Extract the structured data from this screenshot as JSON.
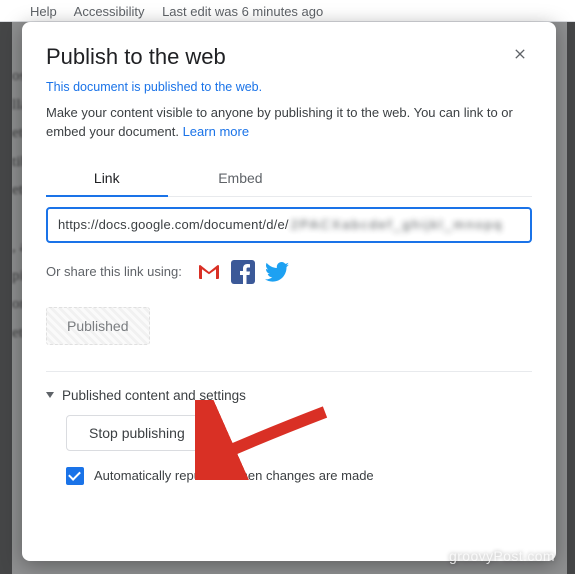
{
  "background": {
    "menu_help": "Help",
    "menu_acc": "Accessibility",
    "last_edit": "Last edit was 6 minutes ago"
  },
  "dialog": {
    "title": "Publish to the web",
    "published_status": "This document is published to the web.",
    "description_main": "Make your content visible to anyone by publishing it to the web. You can link to or embed your document. ",
    "learn_more": "Learn more",
    "tabs": {
      "link": "Link",
      "embed": "Embed"
    },
    "url_visible": "https://docs.google.com/document/d/e/",
    "share_label": "Or share this link using:",
    "status_button": "Published",
    "expand_label": "Published content and settings",
    "stop_button": "Stop publishing",
    "auto_republish": "Automatically republish when changes are made",
    "auto_republish_checked": true
  },
  "watermark": "groovyPost.com"
}
